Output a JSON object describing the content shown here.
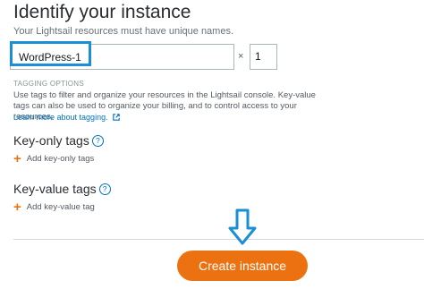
{
  "header": {
    "title": "Identify your instance",
    "subtitle": "Your Lightsail resources must have unique names."
  },
  "name_input": {
    "value": "WordPress-1"
  },
  "multiplier": "×",
  "count_input": {
    "value": "1"
  },
  "tagging": {
    "section_label": "TAGGING OPTIONS",
    "description": "Use tags to filter and organize your resources in the Lightsail console. Key-value tags can also be used to organize your billing, and to control access to your resources.",
    "learn_more": "Learn more about tagging."
  },
  "key_only": {
    "title": "Key-only tags",
    "help": "?",
    "add_label": "Add key-only tags"
  },
  "key_value": {
    "title": "Key-value tags",
    "help": "?",
    "add_label": "Add key-value tag"
  },
  "footer": {
    "create_label": "Create instance"
  },
  "colors": {
    "accent": "#ec7211",
    "link": "#0073bb",
    "highlight": "#1a8fd6"
  },
  "icons": [
    "help-icon",
    "external-link-icon",
    "plus-icon",
    "down-arrow-icon"
  ]
}
